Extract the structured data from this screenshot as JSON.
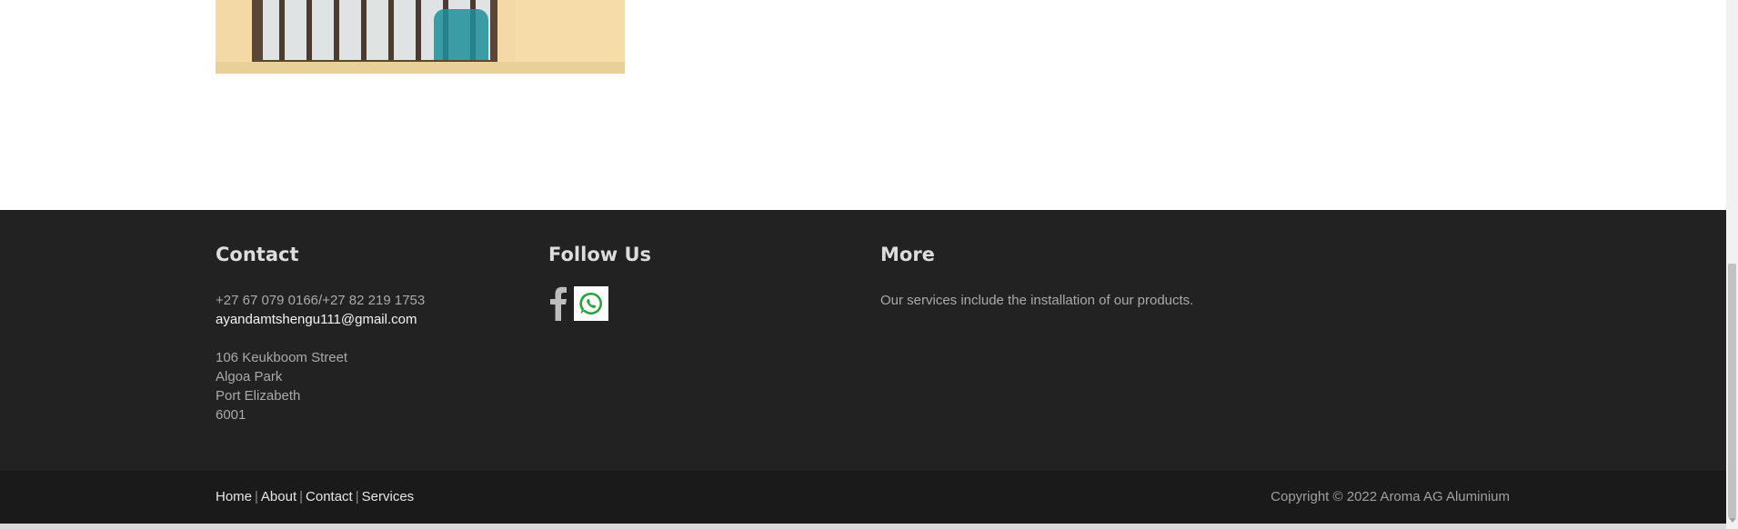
{
  "footer": {
    "contact": {
      "heading": "Contact",
      "phone": "+27 67 079 0166/+27 82 219 1753",
      "email": "ayandamtshengu111@gmail.com",
      "address": [
        "106 Keukboom Street",
        "Algoa Park",
        "Port Elizabeth",
        "6001"
      ]
    },
    "follow": {
      "heading": "Follow Us",
      "icons": [
        "facebook-icon",
        "whatsapp-icon"
      ]
    },
    "more": {
      "heading": "More",
      "text": "Our services include the installation of our products."
    }
  },
  "bottom_bar": {
    "links": [
      "Home",
      "About",
      "Contact",
      "Services"
    ],
    "separator": "|",
    "copyright": "Copyright © 2022 Aroma AG Aluminium"
  },
  "colors": {
    "footer_bg": "#222222",
    "bottom_bg": "#1a1a1a",
    "whatsapp_green": "#25a33c"
  }
}
